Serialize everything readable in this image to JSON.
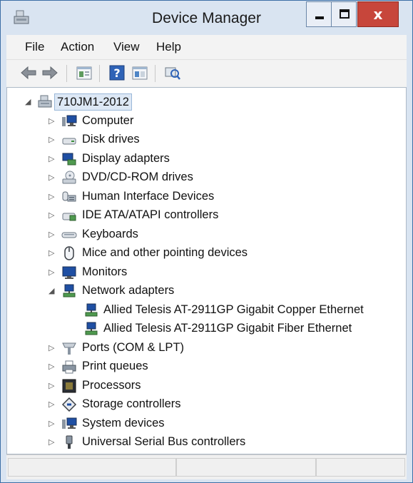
{
  "window": {
    "title": "Device Manager",
    "close_glyph": "x"
  },
  "menu": {
    "file": "File",
    "action": "Action",
    "view": "View",
    "help": "Help"
  },
  "toolbar": {
    "buttons": [
      "back-arrow-icon",
      "forward-arrow-icon",
      "properties-icon",
      "help-icon",
      "toggle-view-icon",
      "scan-hardware-icon"
    ]
  },
  "tree": {
    "root": "710JM1-2012",
    "categories": [
      {
        "label": "Computer",
        "icon": "computer-icon"
      },
      {
        "label": "Disk drives",
        "icon": "disk-drive-icon"
      },
      {
        "label": "Display adapters",
        "icon": "display-adapter-icon"
      },
      {
        "label": "DVD/CD-ROM drives",
        "icon": "dvd-drive-icon"
      },
      {
        "label": "Human Interface Devices",
        "icon": "hid-icon"
      },
      {
        "label": "IDE ATA/ATAPI controllers",
        "icon": "ide-controller-icon"
      },
      {
        "label": "Keyboards",
        "icon": "keyboard-icon"
      },
      {
        "label": "Mice and other pointing devices",
        "icon": "mouse-icon"
      },
      {
        "label": "Monitors",
        "icon": "monitor-icon"
      },
      {
        "label": "Network adapters",
        "icon": "network-adapter-icon",
        "expanded": true,
        "children": [
          {
            "label": "Allied Telesis AT-2911GP Gigabit Copper Ethernet"
          },
          {
            "label": "Allied Telesis AT-2911GP Gigabit Fiber Ethernet"
          }
        ]
      },
      {
        "label": "Ports (COM & LPT)",
        "icon": "port-icon"
      },
      {
        "label": "Print queues",
        "icon": "printer-icon"
      },
      {
        "label": "Processors",
        "icon": "processor-icon"
      },
      {
        "label": "Storage controllers",
        "icon": "storage-controller-icon"
      },
      {
        "label": "System devices",
        "icon": "system-device-icon"
      },
      {
        "label": "Universal Serial Bus controllers",
        "icon": "usb-icon"
      }
    ]
  },
  "colors": {
    "titlebar": "#d9e4f1",
    "close_button": "#c7463b",
    "selection": "#dde8f5"
  }
}
